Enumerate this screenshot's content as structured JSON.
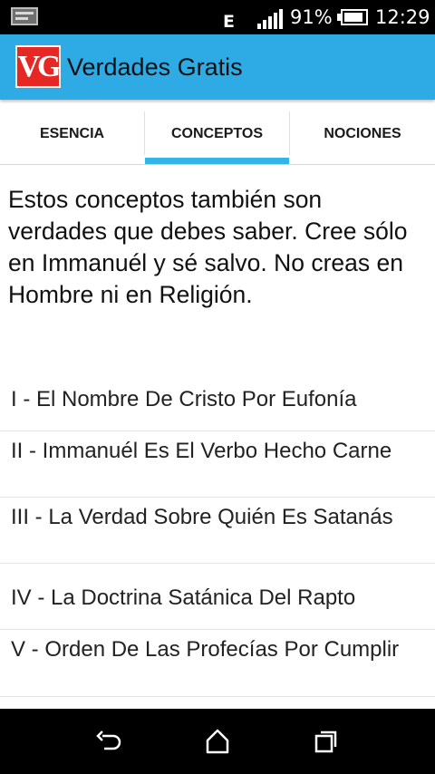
{
  "status_bar": {
    "left_icon": "notification-card-icon",
    "network_type": "E",
    "signal_icon": "signal-bars-icon",
    "battery_percent": "91%",
    "battery_level": 0.91,
    "battery_icon": "battery-icon",
    "time": "12:29"
  },
  "app_bar": {
    "logo_text": "VG",
    "logo_color": "#e52824",
    "background_color": "#2eaae4",
    "title": "Verdades Gratis"
  },
  "tabs": [
    {
      "label": "ESENCIA",
      "selected": false
    },
    {
      "label": "CONCEPTOS",
      "selected": true
    },
    {
      "label": "NOCIONES",
      "selected": false
    }
  ],
  "tab_indicator_color": "#33b5e5",
  "intro_text": "Estos conceptos también son verdades que debes saber. Cree sólo en Immanuél y sé salvo. No creas en Hombre ni en Religión.",
  "chapters": [
    {
      "label": "I - El Nombre De Cristo Por Eufonía"
    },
    {
      "label": "II - Immanuél Es El Verbo Hecho Carne"
    },
    {
      "label": "III - La Verdad Sobre Quién Es Satanás"
    },
    {
      "label": "IV - La Doctrina Satánica Del Rapto"
    },
    {
      "label": "V - Orden De Las Profecías Por Cumplir"
    }
  ],
  "nav_bar": {
    "back_icon": "back-arrow-icon",
    "home_icon": "home-icon",
    "recents_icon": "recent-apps-icon"
  }
}
